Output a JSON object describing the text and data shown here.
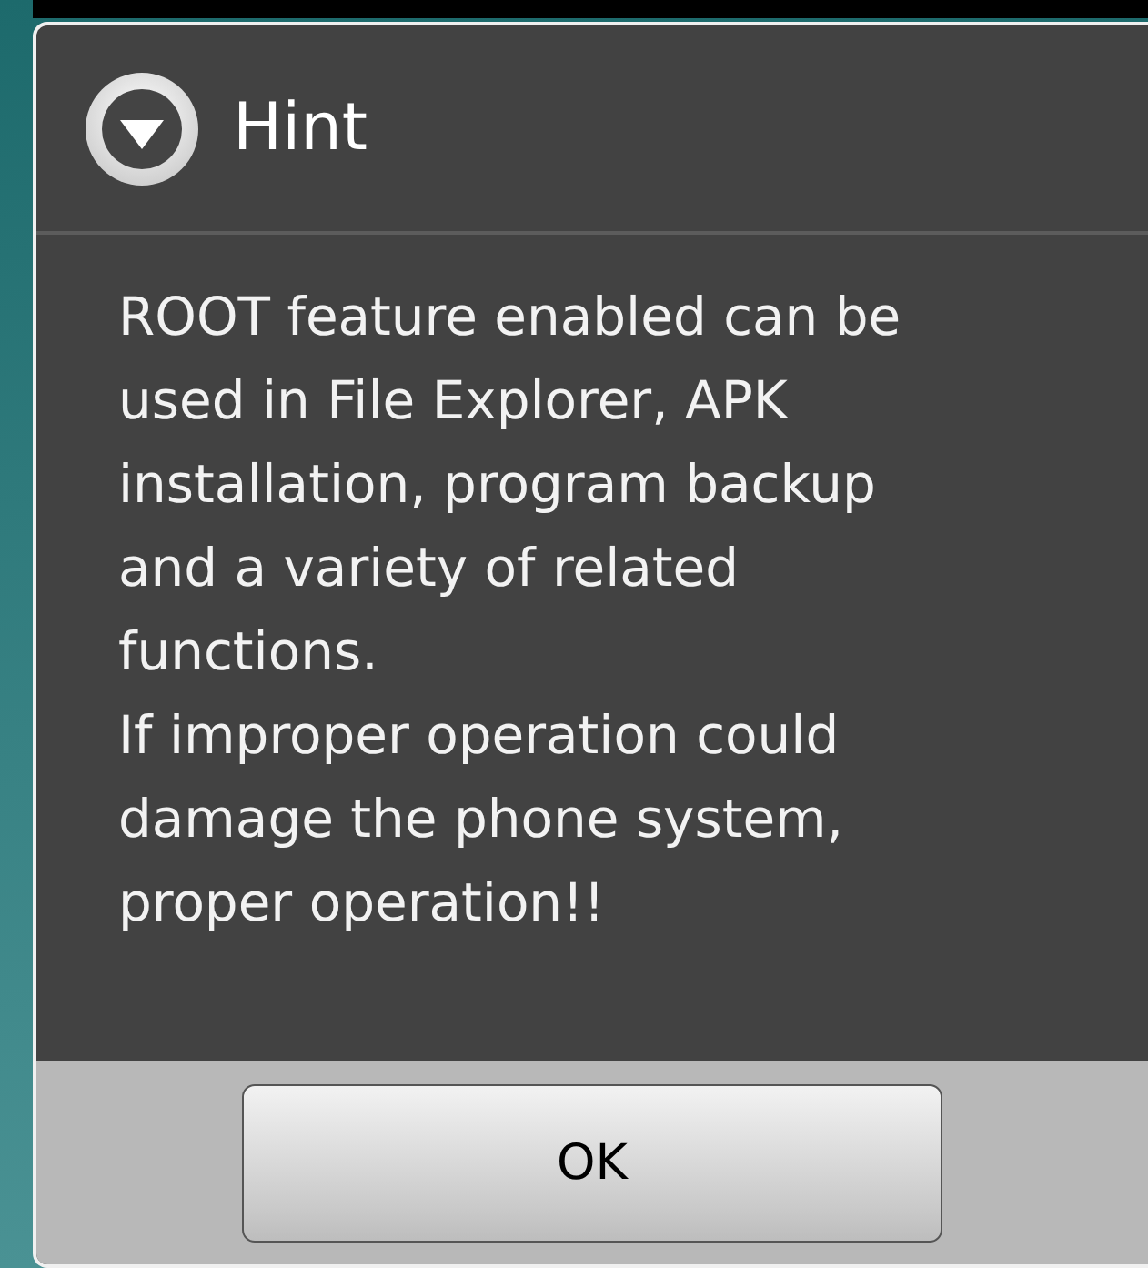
{
  "dialog": {
    "title": "Hint",
    "message": "ROOT feature enabled can be used in File Explorer, APK installation, program backup and a variety of related functions.\nIf improper operation could damage the phone system, proper operation!!",
    "buttons": [
      "OK"
    ]
  }
}
